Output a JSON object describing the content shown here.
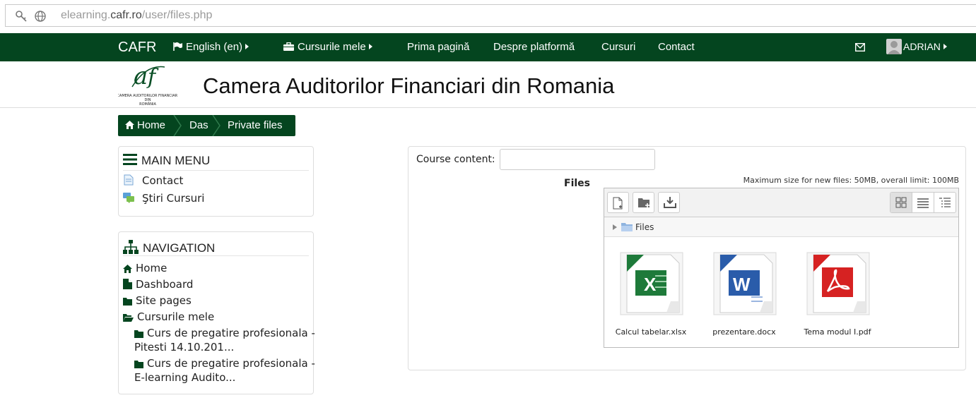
{
  "browser": {
    "url_prefix": "elearning.",
    "url_domain": "cafr.ro",
    "url_path": "/user/files.php"
  },
  "navbar": {
    "brand": "CAFR",
    "language": "English ‎(en)‎",
    "my_courses": "Cursurile mele",
    "links": [
      "Prima pagină",
      "Despre platformă",
      "Cursuri",
      "Contact"
    ],
    "user": "ADRIAN"
  },
  "header": {
    "title": "Camera Auditorilor Financiari din Romania",
    "logo_text": "Camera Auditorilor Financiari din Romania"
  },
  "breadcrumb": [
    "Home",
    "Das",
    "Private files"
  ],
  "main_menu": {
    "title": "MAIN MENU",
    "items": [
      "Contact",
      "Ştiri Cursuri"
    ]
  },
  "navigation": {
    "title": "NAVIGATION",
    "items": [
      "Home",
      "Dashboard",
      "Site pages",
      "Cursurile mele"
    ],
    "courses": [
      {
        "line1": "Curs de pregatire profesionala -",
        "line2": "Pitesti 14.10.201..."
      },
      {
        "line1": "Curs de pregatire profesionala -",
        "line2": "E-learning Audito..."
      }
    ]
  },
  "main": {
    "course_content_label": "Course content:",
    "course_content_value": "",
    "files_label": "Files",
    "max_size": "Maximum size for new files: 50MB, overall limit: 100MB",
    "path_folder": "Files",
    "files": [
      {
        "name": "Calcul tabelar.xlsx",
        "type": "xlsx",
        "color": "#1e7a3a"
      },
      {
        "name": "prezentare.docx",
        "type": "docx",
        "color": "#2a5caa"
      },
      {
        "name": "Tema modul I.pdf",
        "type": "pdf",
        "color": "#d62222"
      }
    ]
  },
  "colors": {
    "brand_green": "#04451f"
  }
}
